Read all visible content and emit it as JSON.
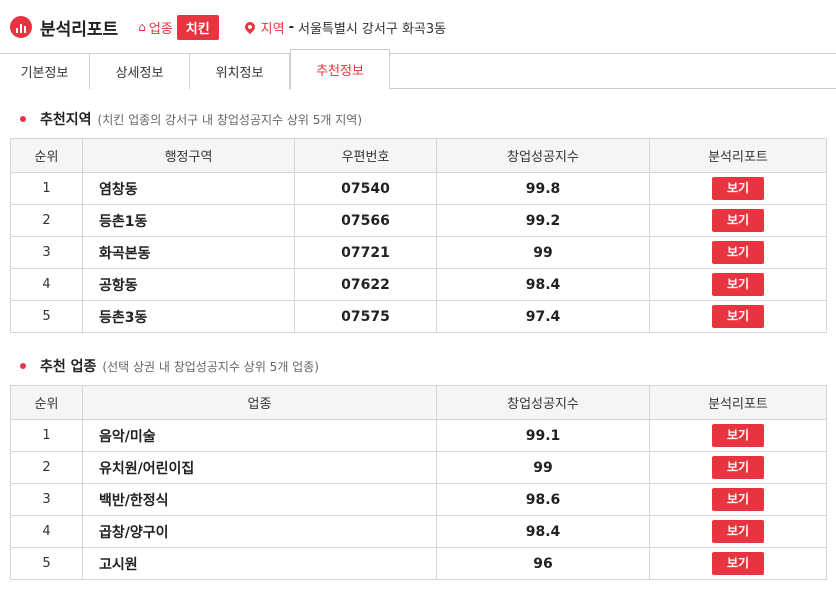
{
  "header": {
    "title": "분석리포트",
    "industry_label": "업종",
    "industry_value": "치킨",
    "region_label": "지역",
    "region_sep": "-",
    "region_value": "서울특별시 강서구 화곡3동"
  },
  "tabs": [
    {
      "label": "기본정보"
    },
    {
      "label": "상세정보"
    },
    {
      "label": "위치정보"
    },
    {
      "label": "추천정보"
    }
  ],
  "regions": {
    "title": "추천지역",
    "subtitle": "(치킨 업종의 강서구 내 창업성공지수 상위 5개 지역)",
    "columns": [
      "순위",
      "행정구역",
      "우편번호",
      "창업성공지수",
      "분석리포트"
    ],
    "rows": [
      {
        "rank": "1",
        "name": "염창동",
        "postal": "07540",
        "score": "99.8",
        "button": "보기"
      },
      {
        "rank": "2",
        "name": "등촌1동",
        "postal": "07566",
        "score": "99.2",
        "button": "보기"
      },
      {
        "rank": "3",
        "name": "화곡본동",
        "postal": "07721",
        "score": "99",
        "button": "보기"
      },
      {
        "rank": "4",
        "name": "공항동",
        "postal": "07622",
        "score": "98.4",
        "button": "보기"
      },
      {
        "rank": "5",
        "name": "등촌3동",
        "postal": "07575",
        "score": "97.4",
        "button": "보기"
      }
    ]
  },
  "industries": {
    "title": "추천 업종",
    "subtitle": "(선택 상권 내 창업성공지수 상위 5개 업종)",
    "columns": [
      "순위",
      "업종",
      "창업성공지수",
      "분석리포트"
    ],
    "rows": [
      {
        "rank": "1",
        "name": "음악/미술",
        "score": "99.1",
        "button": "보기"
      },
      {
        "rank": "2",
        "name": "유치원/어린이집",
        "score": "99",
        "button": "보기"
      },
      {
        "rank": "3",
        "name": "백반/한정식",
        "score": "98.6",
        "button": "보기"
      },
      {
        "rank": "4",
        "name": "곱창/양구이",
        "score": "98.4",
        "button": "보기"
      },
      {
        "rank": "5",
        "name": "고시원",
        "score": "96",
        "button": "보기"
      }
    ]
  },
  "colors": {
    "accent": "#e8343f"
  }
}
